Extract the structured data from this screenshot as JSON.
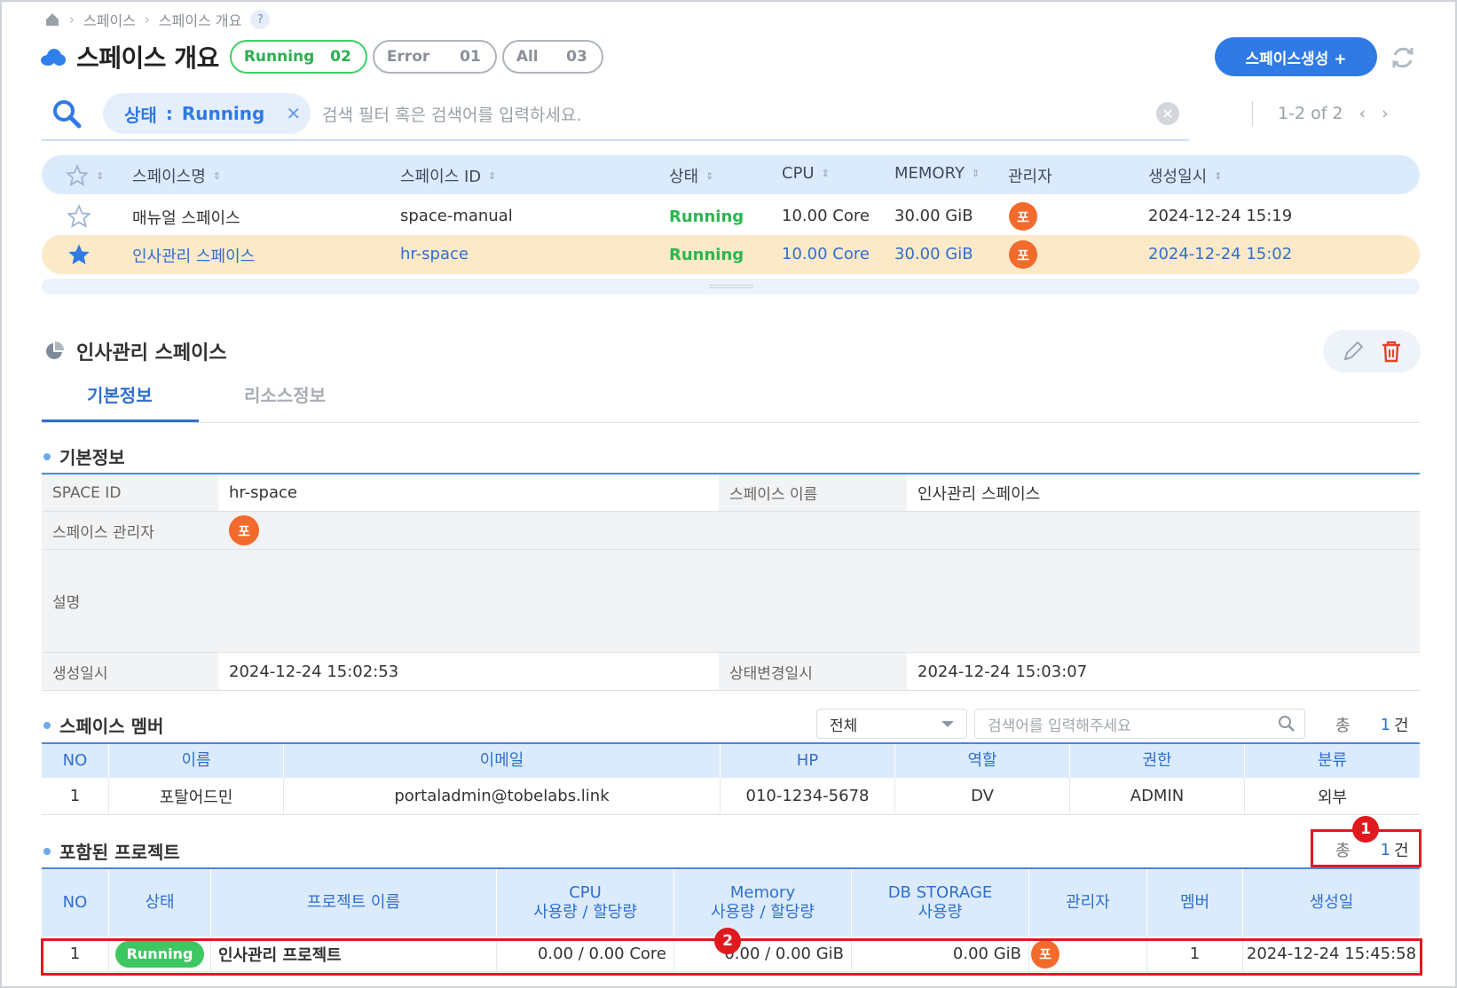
{
  "breadcrumb": {
    "items": [
      "스페이스",
      "스페이스 개요"
    ],
    "help": "?"
  },
  "header": {
    "title": "스페이스 개요",
    "filters": [
      {
        "label": "Running",
        "count": "02"
      },
      {
        "label": "Error",
        "count": "01"
      },
      {
        "label": "All",
        "count": "03"
      }
    ],
    "create_label": "스페이스생성 +"
  },
  "search": {
    "chip_key": "상태",
    "chip_colon": ":",
    "chip_value": "Running",
    "chip_remove": "✕",
    "placeholder": "검색 필터 혹은 검색어를 입력하세요.",
    "pager": "1-2 of 2"
  },
  "spaces_table": {
    "headers": {
      "name": "스페이스명",
      "id": "스페이스 ID",
      "status": "상태",
      "cpu": "CPU",
      "memory": "MEMORY",
      "admin": "관리자",
      "created": "생성일시"
    },
    "rows": [
      {
        "favorite": false,
        "name": "매뉴얼 스페이스",
        "id": "space-manual",
        "status": "Running",
        "cpu": "10.00 Core",
        "memory": "30.00 GiB",
        "admin": "포",
        "created": "2024-12-24 15:19"
      },
      {
        "favorite": true,
        "name": "인사관리 스페이스",
        "id": "hr-space",
        "status": "Running",
        "cpu": "10.00 Core",
        "memory": "30.00 GiB",
        "admin": "포",
        "created": "2024-12-24 15:02"
      }
    ]
  },
  "detail": {
    "title": "인사관리 스페이스",
    "tabs": [
      "기본정보",
      "리소스정보"
    ],
    "basic_section": "기본정보",
    "info": {
      "space_id_label": "SPACE ID",
      "space_id": "hr-space",
      "space_name_label": "스페이스 이름",
      "space_name": "인사관리 스페이스",
      "admin_label": "스페이스 관리자",
      "admin": "포",
      "desc_label": "설명",
      "desc": "",
      "created_label": "생성일시",
      "created": "2024-12-24 15:02:53",
      "status_changed_label": "상태변경일시",
      "status_changed": "2024-12-24 15:03:07"
    },
    "members": {
      "section": "스페이스 멤버",
      "filter_value": "전체",
      "search_placeholder": "검색어를 입력해주세요",
      "total_label": "총",
      "total": "1",
      "unit": "건",
      "headers": [
        "NO",
        "이름",
        "이메일",
        "HP",
        "역할",
        "권한",
        "분류"
      ],
      "rows": [
        [
          "1",
          "포탈어드민",
          "portaladmin@tobelabs.link",
          "010-1234-5678",
          "DV",
          "ADMIN",
          "외부"
        ]
      ]
    },
    "projects": {
      "section": "포함된 프로젝트",
      "total_label": "총",
      "total": "1",
      "unit": "건",
      "headers": {
        "no": "NO",
        "status": "상태",
        "name": "프로젝트 이름",
        "cpu": "CPU",
        "cpu_sub": "사용량 / 할당량",
        "memory": "Memory",
        "memory_sub": "사용량 / 할당량",
        "db": "DB STORAGE",
        "db_sub": "사용량",
        "admin": "관리자",
        "member": "멤버",
        "created": "생성일"
      },
      "rows": [
        {
          "no": "1",
          "status": "Running",
          "name": "인사관리 프로젝트",
          "cpu": "0.00 / 0.00 Core",
          "memory": "0.00 / 0.00 GiB",
          "db": "0.00 GiB",
          "admin": "포",
          "member": "1",
          "created": "2024-12-24 15:45:58"
        }
      ]
    }
  },
  "annotations": [
    "1",
    "2"
  ],
  "colors": {
    "accent": "#2f7ae5",
    "running": "#3ccf66",
    "highlight": "#fbe9c8",
    "annotation": "#e0191f"
  }
}
